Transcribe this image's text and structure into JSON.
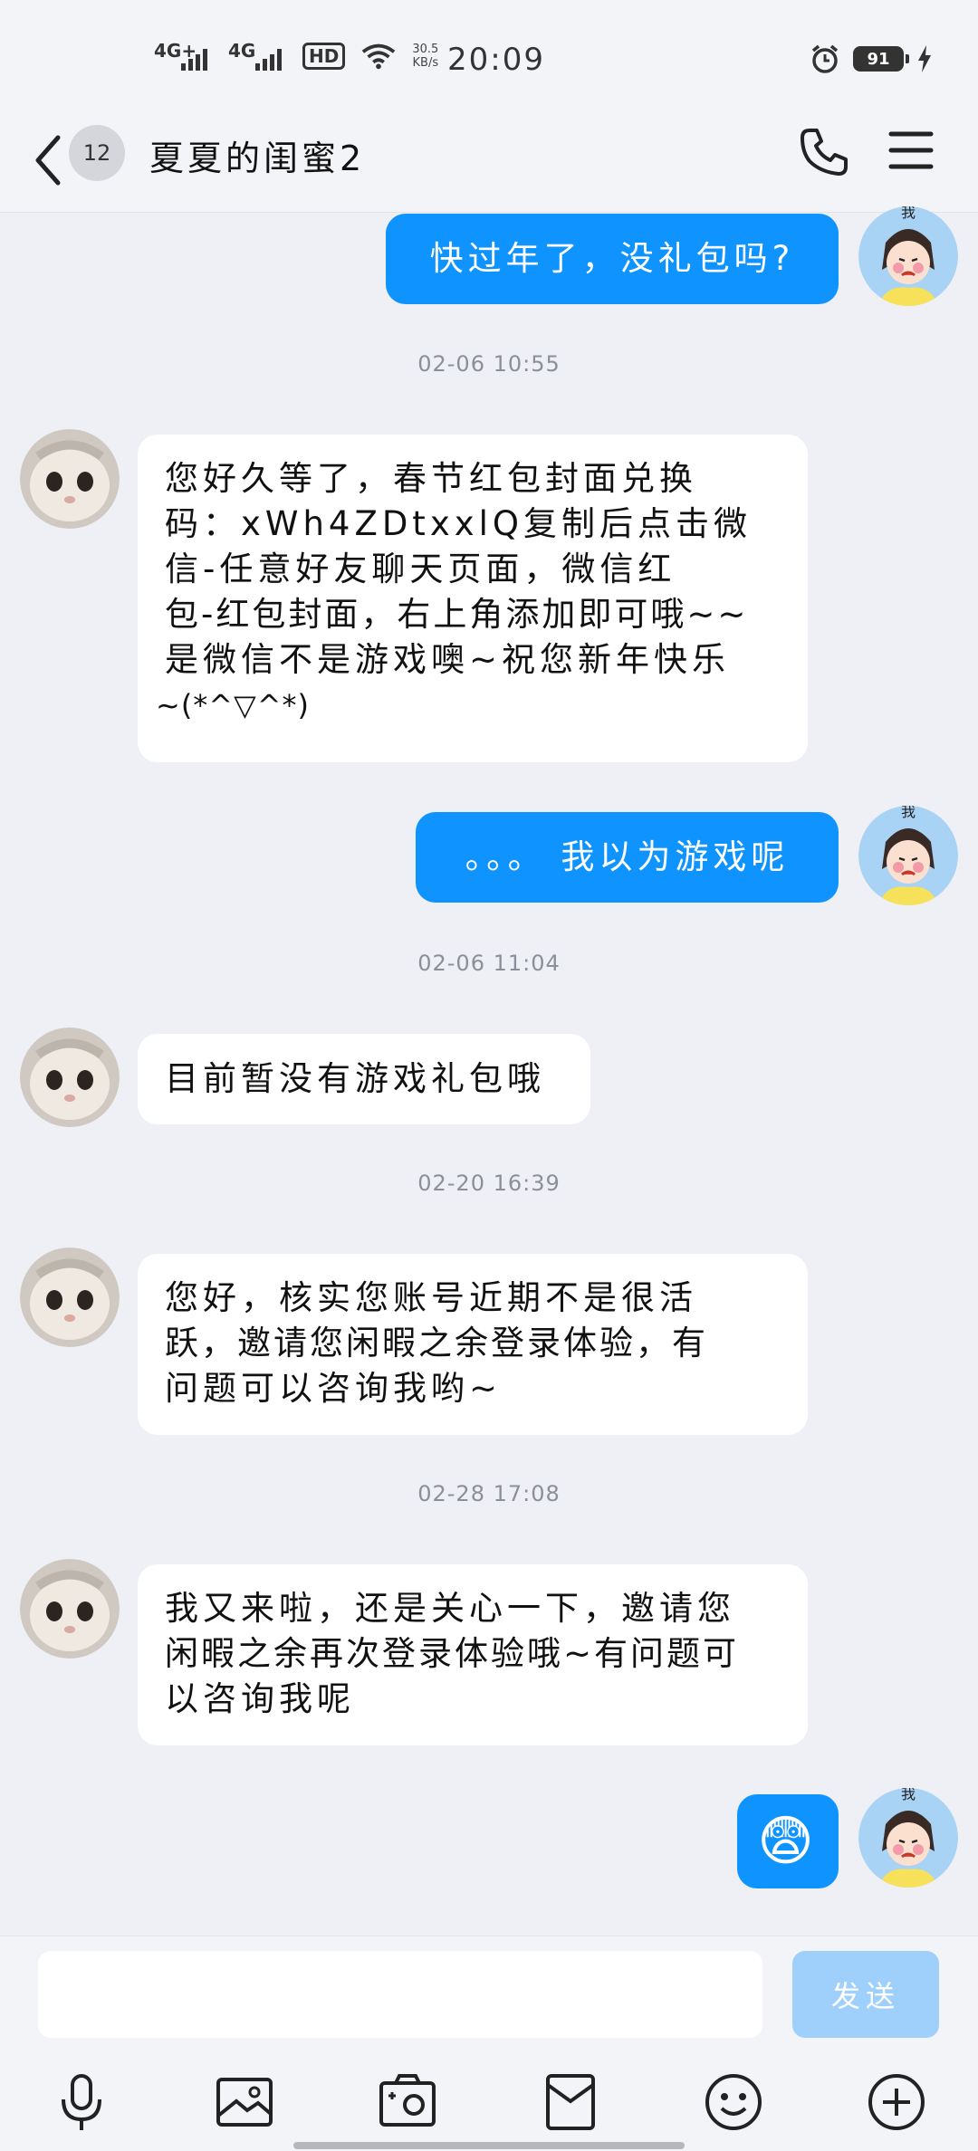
{
  "status_bar": {
    "signal1": "4G+",
    "signal2": "4G",
    "hd": "HD",
    "speed_value": "30.5",
    "speed_unit": "KB/s",
    "time": "20:09",
    "battery": "91"
  },
  "header": {
    "unread_count": "12",
    "title": "夏夏的闺蜜2"
  },
  "messages": [
    {
      "side": "out",
      "text": "快过年了，没礼包吗?"
    },
    {
      "timestamp": "02-06 10:55"
    },
    {
      "side": "in",
      "text": "您好久等了，春节红包封面兑换码：xWh4ZDtxxlQ复制后点击微信-任意好友聊天页面，微信红包-红包封面，右上角添加即可哦~~是微信不是游戏噢~祝您新年快乐~(*^▽^*)"
    },
    {
      "side": "out",
      "text": "。。。 我以为游戏呢"
    },
    {
      "timestamp": "02-06 11:04"
    },
    {
      "side": "in",
      "text": "目前暂没有游戏礼包哦"
    },
    {
      "timestamp": "02-20 16:39"
    },
    {
      "side": "in",
      "text": "您好，核实您账号近期不是很活跃，邀请您闲暇之余登录体验，有问题可以咨询我哟~"
    },
    {
      "timestamp": "02-28 17:08"
    },
    {
      "side": "in",
      "text": "我又来啦，还是关心一下，邀请您闲暇之余再次登录体验哦~有问题可以咨询我呢"
    },
    {
      "side": "out",
      "emoji": "😨"
    }
  ],
  "bubbles": {
    "m1": "快过年了，没礼包吗?",
    "ts1": "02-06 10:55",
    "m2_l1": "您好久等了，春节红包封面兑换",
    "m2_l2": "码：xWh4ZDtxxlQ复制后点击微",
    "m2_l3": "信-任意好友聊天页面，微信红",
    "m2_l4": "包-红包封面，右上角添加即可哦~~",
    "m2_l5": "是微信不是游戏噢~祝您新年快乐",
    "m2_l6": "~(*^▽^*)",
    "m3": "。。。 我以为游戏呢",
    "ts2": "02-06 11:04",
    "m4": "目前暂没有游戏礼包哦",
    "ts3": "02-20 16:39",
    "m5_l1": "您好，核实您账号近期不是很活",
    "m5_l2": "跃，邀请您闲暇之余登录体验，有",
    "m5_l3": "问题可以咨询我哟~",
    "ts4": "02-28 17:08",
    "m6_l1": "我又来啦，还是关心一下，邀请您",
    "m6_l2": "闲暇之余再次登录体验哦~有问题可",
    "m6_l3": "以咨询我呢",
    "m7_emoji": "😨"
  },
  "avatars": {
    "me_label": "我"
  },
  "input": {
    "placeholder": "",
    "send_label": "发送"
  },
  "toolbar": [
    "microphone-icon",
    "image-icon",
    "camera-icon",
    "red-packet-icon",
    "emoji-icon",
    "plus-icon"
  ],
  "colors": {
    "outgoing_bubble": "#0e93ff",
    "incoming_bubble": "#ffffff",
    "background": "#eef0f5",
    "send_button_disabled": "#9fd0fb"
  }
}
